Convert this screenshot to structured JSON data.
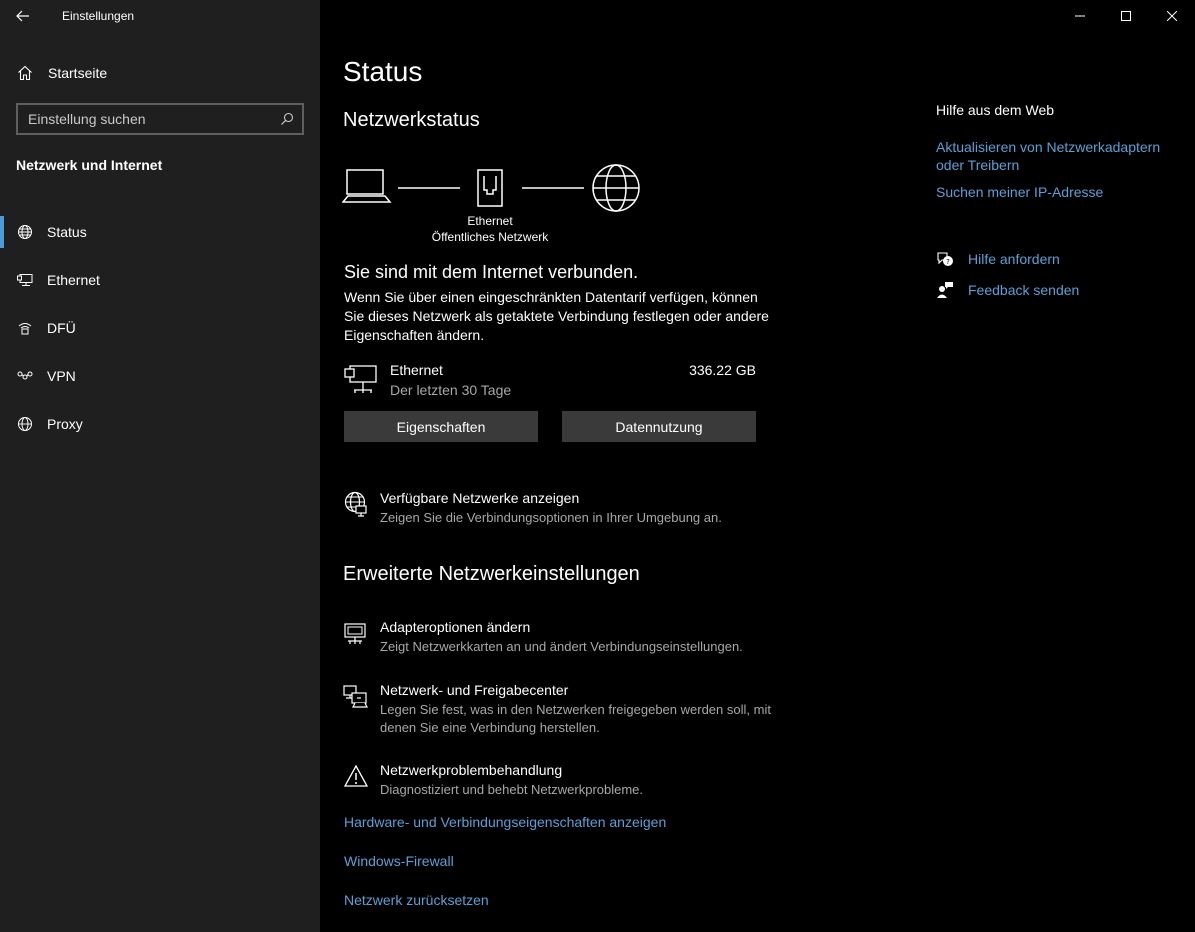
{
  "window": {
    "title": "Einstellungen"
  },
  "sidebar": {
    "home_label": "Startseite",
    "search_placeholder": "Einstellung suchen",
    "section_title": "Netzwerk und Internet",
    "items": [
      {
        "label": "Status",
        "icon": "globe-status-icon",
        "active": true
      },
      {
        "label": "Ethernet",
        "icon": "ethernet-icon"
      },
      {
        "label": "DFÜ",
        "icon": "dialup-icon"
      },
      {
        "label": "VPN",
        "icon": "vpn-icon"
      },
      {
        "label": "Proxy",
        "icon": "globe-icon"
      }
    ]
  },
  "main": {
    "page_title": "Status",
    "network_status_heading": "Netzwerkstatus",
    "diagram": {
      "adapter_label": "Ethernet",
      "network_type": "Öffentliches Netzwerk"
    },
    "connected_text": "Sie sind mit dem Internet verbunden.",
    "description": "Wenn Sie über einen eingeschränkten Datentarif verfügen, können Sie dieses Netzwerk als getaktete Verbindung festlegen oder andere Eigenschaften ändern.",
    "adapter": {
      "name": "Ethernet",
      "period": "Der letzten 30 Tage",
      "usage": "336.22 GB"
    },
    "buttons": {
      "properties": "Eigenschaften",
      "data_usage": "Datennutzung"
    },
    "available_networks": {
      "title": "Verfügbare Netzwerke anzeigen",
      "subtitle": "Zeigen Sie die Verbindungsoptionen in Ihrer Umgebung an."
    },
    "advanced_heading": "Erweiterte Netzwerkeinstellungen",
    "advanced_items": [
      {
        "title": "Adapteroptionen ändern",
        "subtitle": "Zeigt Netzwerkkarten an und ändert Verbindungseinstellungen."
      },
      {
        "title": "Netzwerk- und Freigabecenter",
        "subtitle": "Legen Sie fest, was in den Netzwerken freigegeben werden soll, mit denen Sie eine Verbindung herstellen."
      },
      {
        "title": "Netzwerkproblembehandlung",
        "subtitle": "Diagnostiziert und behebt Netzwerkprobleme."
      }
    ],
    "links": [
      "Hardware- und Verbindungseigenschaften anzeigen",
      "Windows-Firewall",
      "Netzwerk zurücksetzen"
    ]
  },
  "help": {
    "title": "Hilfe aus dem Web",
    "links": [
      "Aktualisieren von Netzwerkadaptern oder Treibern",
      "Suchen meiner IP-Adresse"
    ],
    "get_help": "Hilfe anfordern",
    "feedback": "Feedback senden"
  },
  "colors": {
    "accent": "#5aa0d6",
    "sidebar_bg": "#1f1f1f",
    "main_bg": "#000000",
    "button_bg": "#3a3a3a"
  }
}
